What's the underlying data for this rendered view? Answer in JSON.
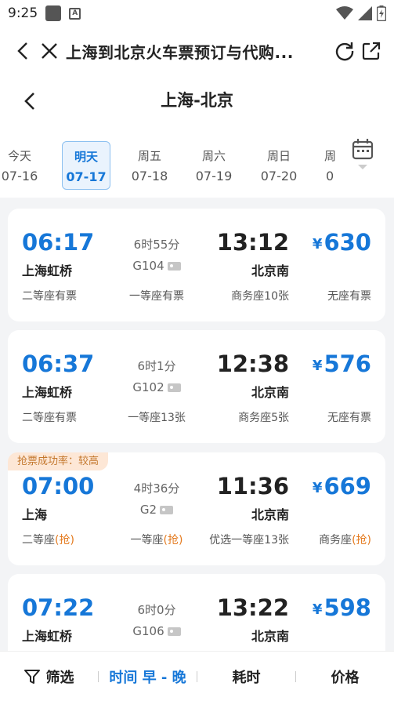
{
  "status_bar": {
    "time": "9:25"
  },
  "browser": {
    "title": "上海到北京火车票预订与代购..."
  },
  "header": {
    "title": "上海-北京"
  },
  "dates": [
    {
      "weekday": "今天",
      "date": "07-16",
      "selected": false
    },
    {
      "weekday": "明天",
      "date": "07-17",
      "selected": true
    },
    {
      "weekday": "周五",
      "date": "07-18",
      "selected": false
    },
    {
      "weekday": "周六",
      "date": "07-19",
      "selected": false
    },
    {
      "weekday": "周日",
      "date": "07-20",
      "selected": false
    },
    {
      "weekday": "周",
      "date": "0",
      "selected": false
    }
  ],
  "trains": [
    {
      "tag": "",
      "dep_time": "06:17",
      "dep_station": "上海虹桥",
      "duration": "6时55分",
      "train_no": "G104",
      "arr_time": "13:12",
      "arr_station": "北京南",
      "currency": "¥",
      "price": "630",
      "seats": [
        {
          "name": "二等座",
          "status": "有票"
        },
        {
          "name": "一等座",
          "status": "有票"
        },
        {
          "name": "商务座",
          "status": "10张"
        },
        {
          "name": "无座",
          "status": "有票"
        }
      ]
    },
    {
      "tag": "",
      "dep_time": "06:37",
      "dep_station": "上海虹桥",
      "duration": "6时1分",
      "train_no": "G102",
      "arr_time": "12:38",
      "arr_station": "北京南",
      "currency": "¥",
      "price": "576",
      "seats": [
        {
          "name": "二等座",
          "status": "有票"
        },
        {
          "name": "一等座",
          "status": "13张"
        },
        {
          "name": "商务座",
          "status": "5张"
        },
        {
          "name": "无座",
          "status": "有票"
        }
      ]
    },
    {
      "tag": "抢票成功率：较高",
      "dep_time": "07:00",
      "dep_station": "上海",
      "duration": "4时36分",
      "train_no": "G2",
      "arr_time": "11:36",
      "arr_station": "北京南",
      "currency": "¥",
      "price": "669",
      "seats": [
        {
          "name": "二等座",
          "status": "(抢)"
        },
        {
          "name": "一等座",
          "status": "(抢)"
        },
        {
          "name": "优选一等座",
          "status": "13张"
        },
        {
          "name": "商务座",
          "status": "(抢)"
        }
      ]
    },
    {
      "tag": "",
      "dep_time": "07:22",
      "dep_station": "上海虹桥",
      "duration": "6时0分",
      "train_no": "G106",
      "arr_time": "13:22",
      "arr_station": "北京南",
      "currency": "¥",
      "price": "598",
      "seats": []
    }
  ],
  "bottom_bar": {
    "filter": "筛选",
    "time_sort": "时间 早 - 晚",
    "duration_sort": "耗时",
    "price_sort": "价格"
  },
  "colors": {
    "accent": "#1677d8",
    "grab": "#e47a1e",
    "tag_bg": "#fde7d6"
  }
}
